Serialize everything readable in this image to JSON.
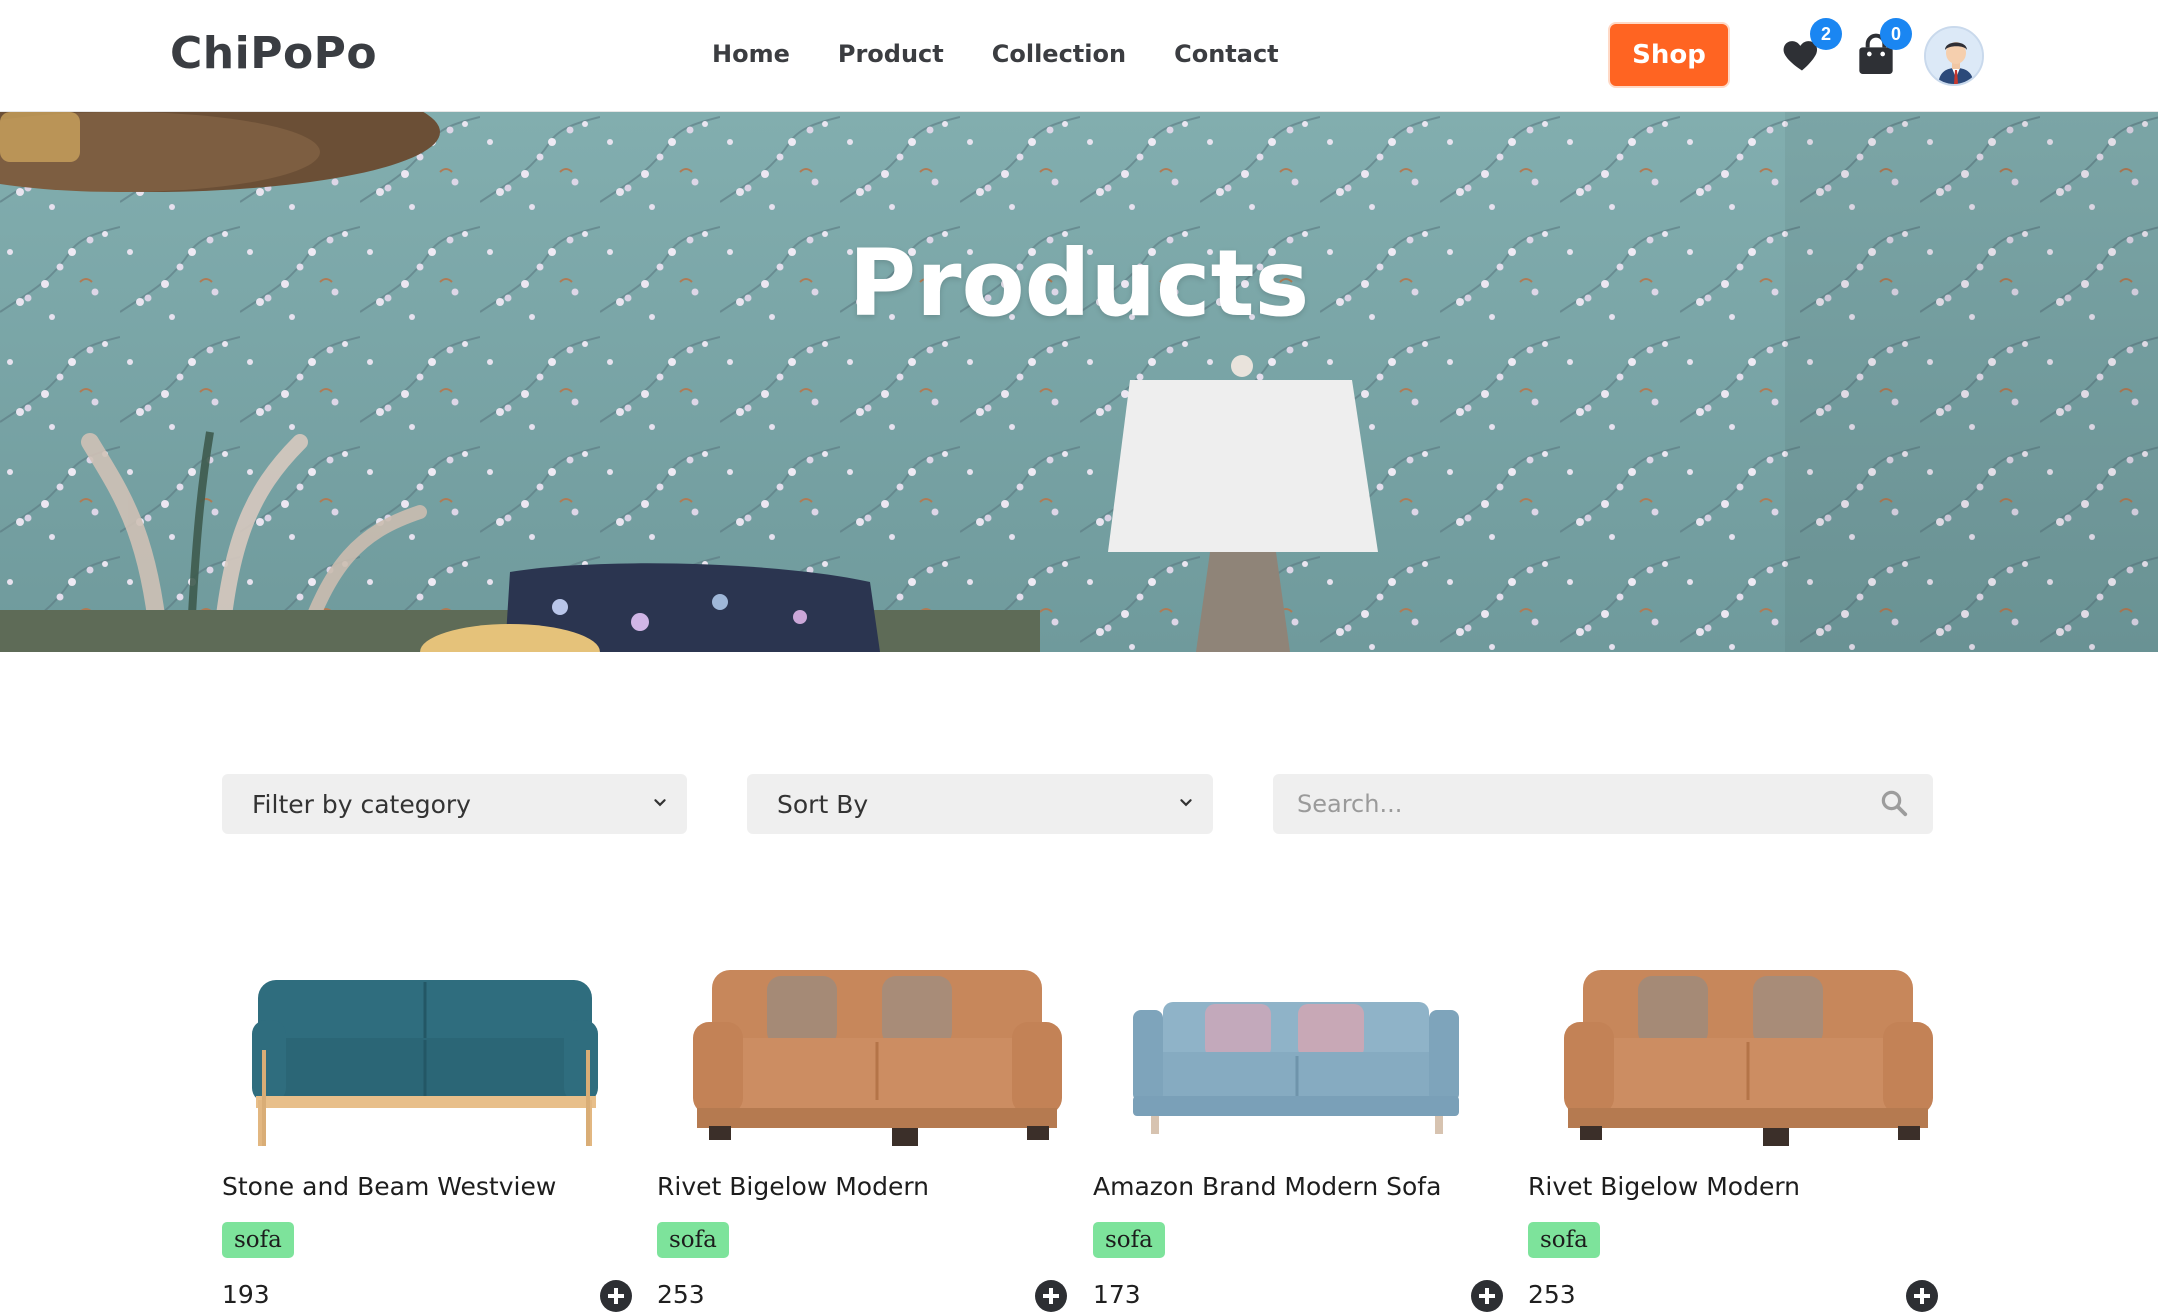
{
  "brand": {
    "logo": "ChiPoPo"
  },
  "nav": {
    "links": [
      {
        "label": "Home"
      },
      {
        "label": "Product"
      },
      {
        "label": "Collection"
      },
      {
        "label": "Contact"
      }
    ],
    "shop_label": "Shop",
    "wishlist_count": "2",
    "cart_count": "0",
    "icons": [
      "heart-icon",
      "bag-icon",
      "avatar"
    ]
  },
  "hero": {
    "title": "Products"
  },
  "filters": {
    "category": {
      "selected": "Filter by category"
    },
    "sort": {
      "selected": "Sort By"
    },
    "search": {
      "placeholder": "Search...",
      "value": ""
    }
  },
  "products": [
    {
      "name": "Stone and Beam Westview",
      "tag": "sofa",
      "price": "193",
      "color": "#2f6d7e"
    },
    {
      "name": "Rivet Bigelow Modern",
      "tag": "sofa",
      "price": "253",
      "color": "#c98a5f"
    },
    {
      "name": "Amazon Brand Modern Sofa",
      "tag": "sofa",
      "price": "173",
      "color": "#8fb3c8"
    },
    {
      "name": "Rivet Bigelow Modern",
      "tag": "sofa",
      "price": "253",
      "color": "#c98a5f"
    }
  ],
  "colors": {
    "accent": "#ff6422",
    "badge": "#1a86f2",
    "tag": "#7de39b",
    "field_bg": "#efefef"
  }
}
